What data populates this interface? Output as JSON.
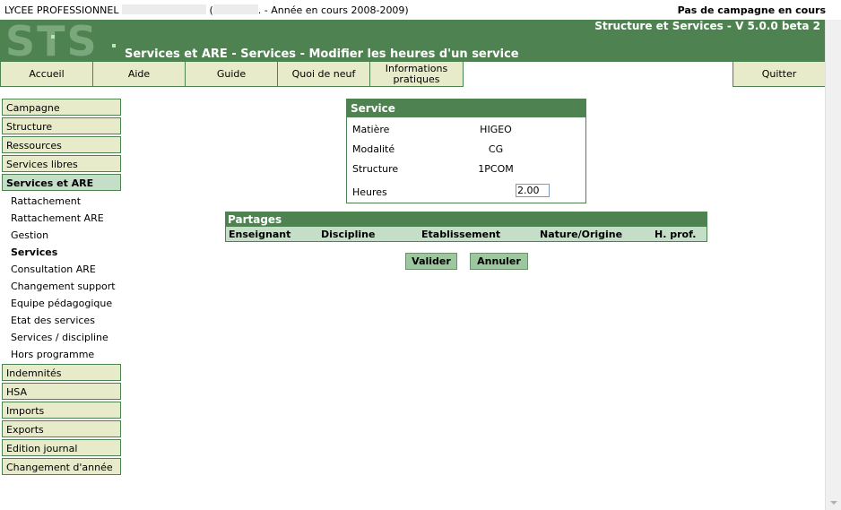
{
  "header": {
    "school_prefix": "LYCEE PROFESSIONNEL",
    "school_mid": "(",
    "school_suffix": ". - Année en cours 2008-2009)",
    "campaign_status": "Pas de campagne en cours",
    "logo_text": "STS",
    "app_title": "Structure et Services - V 5.0.0 beta 2",
    "page_title": "Services et ARE - Services - Modifier les heures d'un service"
  },
  "menu": {
    "accueil": "Accueil",
    "aide": "Aide",
    "guide": "Guide",
    "quoi_de_neuf": "Quoi de neuf",
    "informations_pratiques_1": "Informations",
    "informations_pratiques_2": "pratiques",
    "quitter": "Quitter"
  },
  "sidebar": {
    "items_top": [
      "Campagne",
      "Structure",
      "Ressources",
      "Services libres",
      "Services et ARE"
    ],
    "sub_items": [
      "Rattachement",
      "Rattachement ARE",
      "Gestion",
      "Services",
      "Consultation ARE",
      "Changement support",
      "Equipe pédagogique",
      "Etat des services",
      "Services / discipline",
      "Hors programme"
    ],
    "items_bottom": [
      "Indemnités",
      "HSA",
      "Imports",
      "Exports",
      "Edition journal",
      "Changement d'année"
    ]
  },
  "service": {
    "title": "Service",
    "matiere_label": "Matière",
    "matiere_value": "HIGEO",
    "modalite_label": "Modalité",
    "modalite_value": "CG",
    "structure_label": "Structure",
    "structure_value": "1PCOM",
    "heures_label": "Heures",
    "heures_value": "2.00"
  },
  "partages": {
    "title": "Partages",
    "columns": [
      "Enseignant",
      "Discipline",
      "Etablissement",
      "Nature/Origine",
      "H. prof."
    ]
  },
  "actions": {
    "valider": "Valider",
    "annuler": "Annuler"
  }
}
